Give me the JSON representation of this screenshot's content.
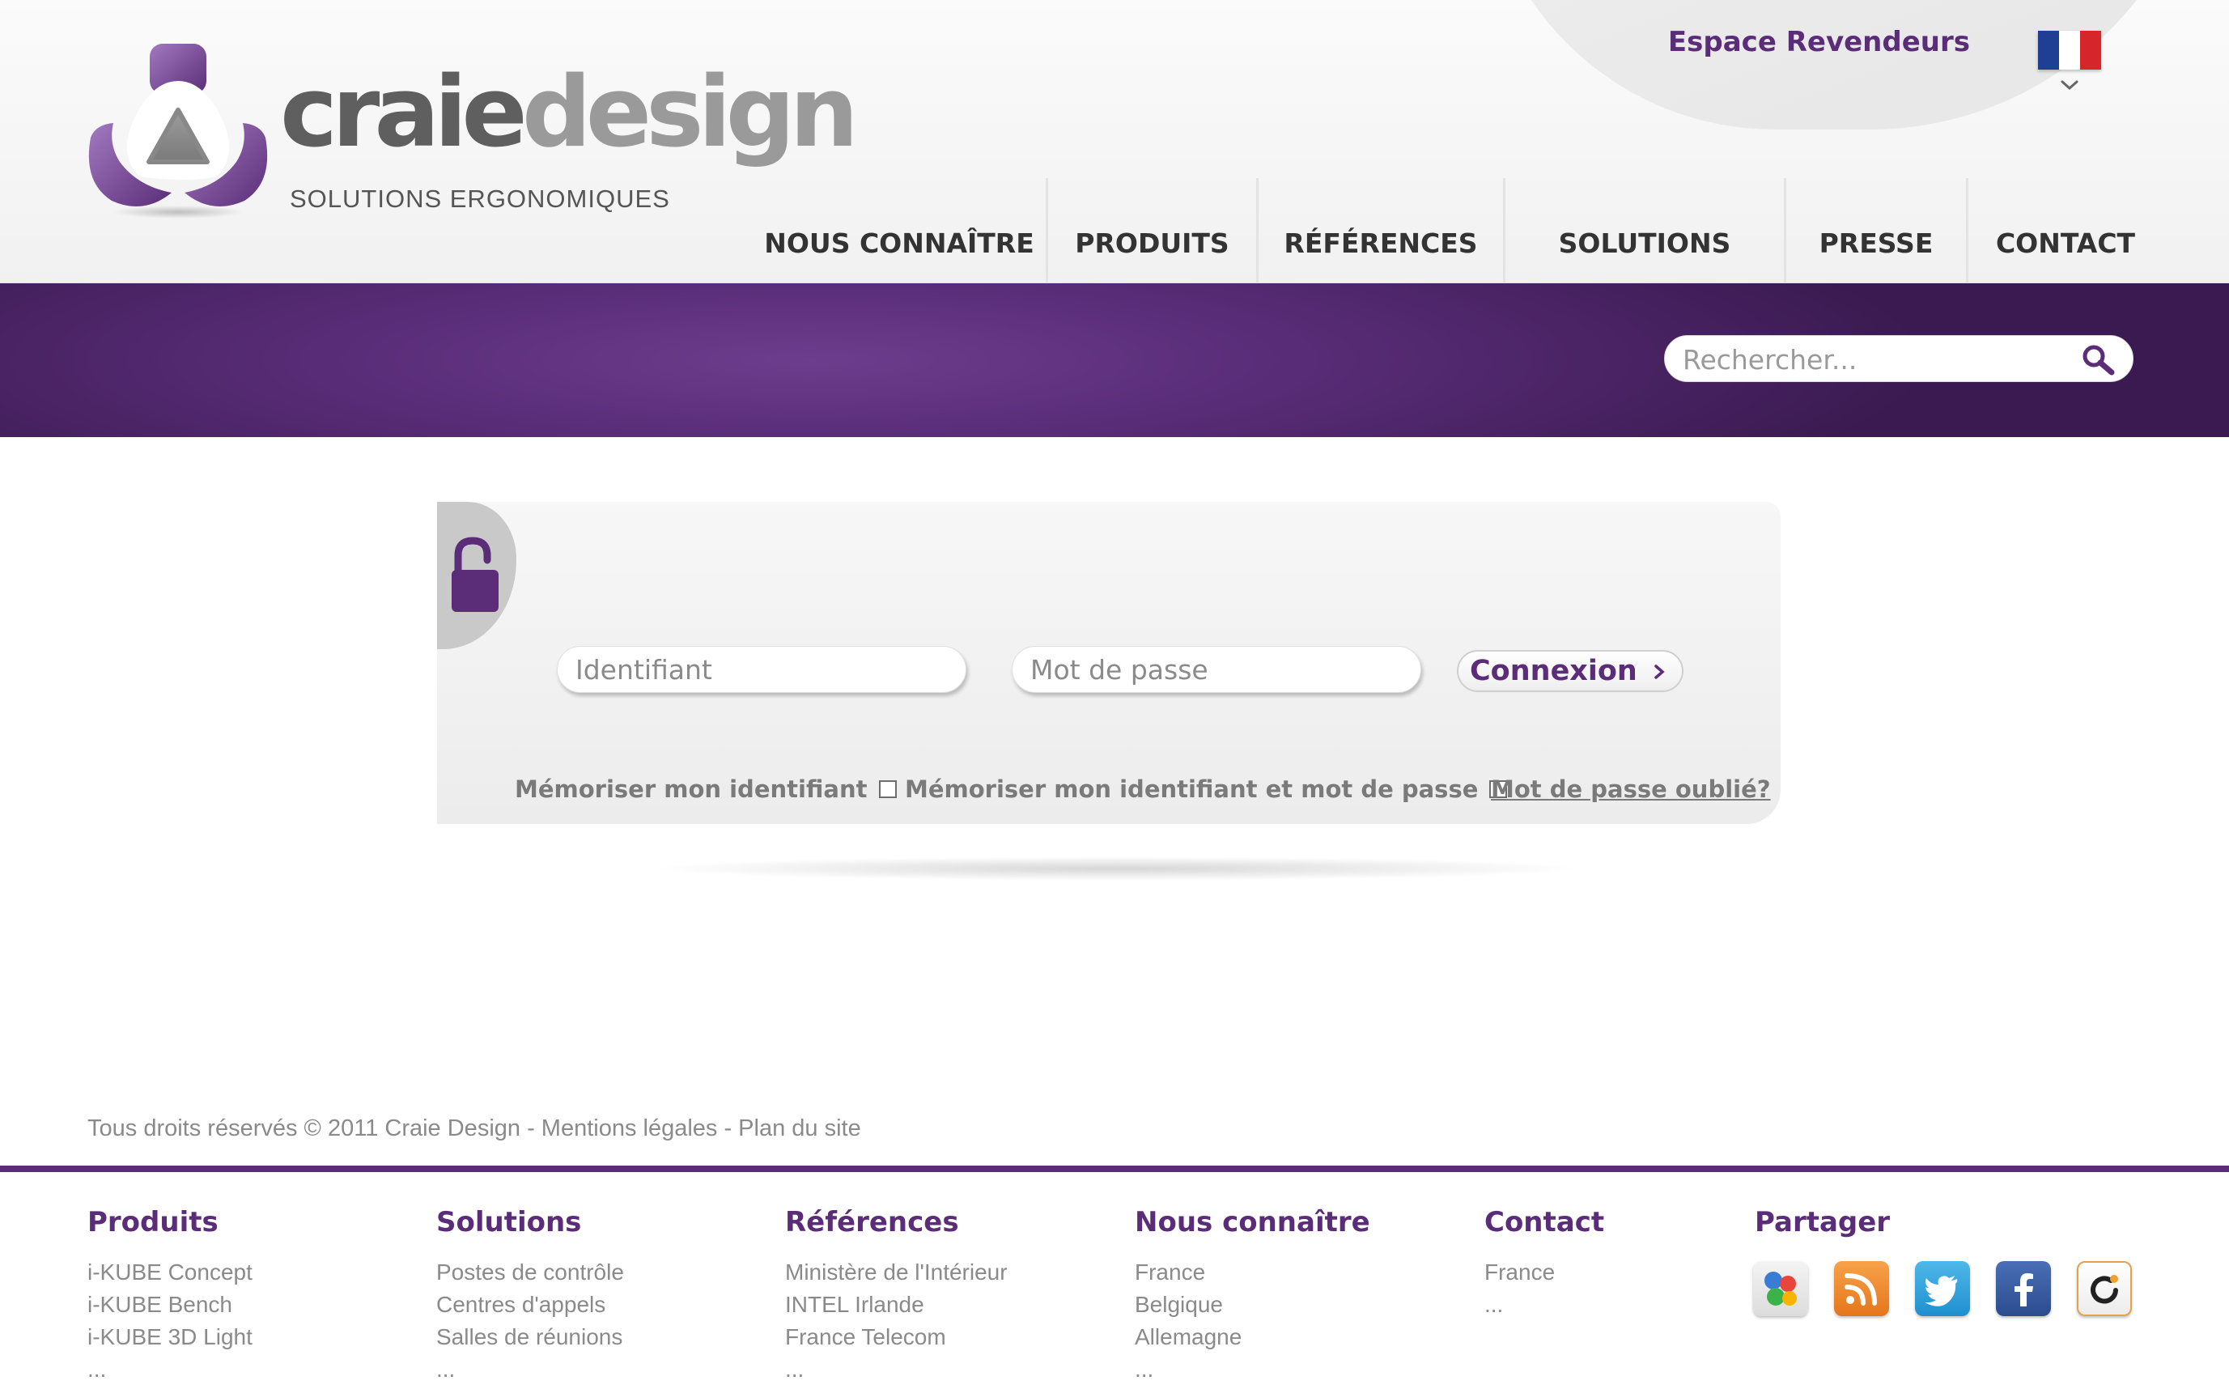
{
  "header": {
    "logo_text_part1": "craie",
    "logo_text_part2": "design",
    "logo_tagline": "SOLUTIONS ERGONOMIQUES",
    "reseller_link": "Espace Revendeurs",
    "language": "fr-flag-icon"
  },
  "nav": {
    "items": [
      {
        "label": "NOUS CONNAÎTRE"
      },
      {
        "label": "PRODUITS"
      },
      {
        "label": "RÉFÉRENCES"
      },
      {
        "label": "SOLUTIONS"
      },
      {
        "label": "PRESSE"
      },
      {
        "label": "CONTACT"
      }
    ]
  },
  "search": {
    "placeholder": "Rechercher..."
  },
  "login": {
    "username_placeholder": "Identifiant",
    "password_placeholder": "Mot de passe",
    "submit_label": "Connexion",
    "remember_id_label": "Mémoriser mon identifiant",
    "remember_both_label": "Mémoriser mon identifiant et mot de passe",
    "forgot_label": "Mot de passe oublié?"
  },
  "footer": {
    "copyright": "Tous droits réservés © 2011 Craie Design - Mentions légales - Plan du site",
    "columns": [
      {
        "heading": "Produits",
        "links": [
          "i-KUBE Concept",
          "i-KUBE Bench",
          "i-KUBE 3D Light",
          "..."
        ]
      },
      {
        "heading": "Solutions",
        "links": [
          "Postes de contrôle",
          "Centres d'appels",
          "Salles de réunions",
          "..."
        ]
      },
      {
        "heading": "Références",
        "links": [
          "Ministère de l'Intérieur",
          "INTEL Irlande",
          "France Telecom",
          "..."
        ]
      },
      {
        "heading": "Nous connaître",
        "links": [
          "France",
          "Belgique",
          "Allemagne",
          "..."
        ]
      },
      {
        "heading": "Contact",
        "links": [
          "France",
          "..."
        ]
      }
    ],
    "share_heading": "Partager",
    "share_icons": [
      "google-icon",
      "rss-icon",
      "twitter-icon",
      "facebook-icon",
      "netvibes-icon"
    ]
  },
  "colors": {
    "brand_purple": "#5b2d78",
    "band_dark": "#3a1a50",
    "text_gray": "#8a8a8a"
  }
}
